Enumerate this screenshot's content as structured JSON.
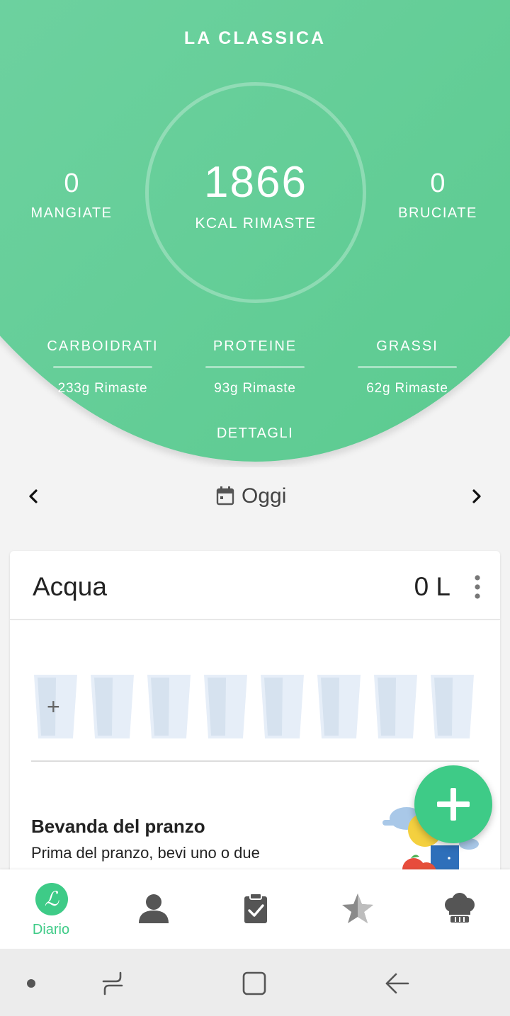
{
  "header": {
    "plan_title": "LA CLASSICA",
    "kcal_remaining": "1866",
    "kcal_label": "KCAL RIMASTE",
    "eaten_value": "0",
    "eaten_label": "MANGIATE",
    "burned_value": "0",
    "burned_label": "BRUCIATE",
    "details_label": "DETTAGLI",
    "accent_color": "#6fd2a1"
  },
  "macros": [
    {
      "name": "CARBOIDRATI",
      "remaining": "233g Rimaste"
    },
    {
      "name": "PROTEINE",
      "remaining": "93g Rimaste"
    },
    {
      "name": "GRASSI",
      "remaining": "62g Rimaste"
    }
  ],
  "date_nav": {
    "prev_icon": "chevron-left-icon",
    "next_icon": "chevron-right-icon",
    "calendar_icon": "calendar-icon",
    "label": "Oggi"
  },
  "water": {
    "title": "Acqua",
    "value": "0 L",
    "glasses_total": 8,
    "glasses_filled": 0,
    "add_glyph": "+"
  },
  "tip": {
    "title": "Bevanda del pranzo",
    "text": "Prima del pranzo, bevi uno o due"
  },
  "fab": {
    "icon": "plus-icon",
    "color": "#3ecb87"
  },
  "bottom_nav": {
    "items": [
      {
        "id": "diary",
        "label": "Diario",
        "icon": "diary-logo-icon",
        "active": true,
        "glyph": "ℒ"
      },
      {
        "id": "profile",
        "label": "",
        "icon": "person-icon",
        "active": false
      },
      {
        "id": "plans",
        "label": "",
        "icon": "clipboard-check-icon",
        "active": false
      },
      {
        "id": "premium",
        "label": "",
        "icon": "star-icon",
        "active": false
      },
      {
        "id": "recipes",
        "label": "",
        "icon": "chef-hat-icon",
        "active": false
      }
    ]
  },
  "system_bar": {
    "buttons": [
      "dot-icon",
      "recents-icon",
      "home-icon",
      "back-icon"
    ]
  }
}
